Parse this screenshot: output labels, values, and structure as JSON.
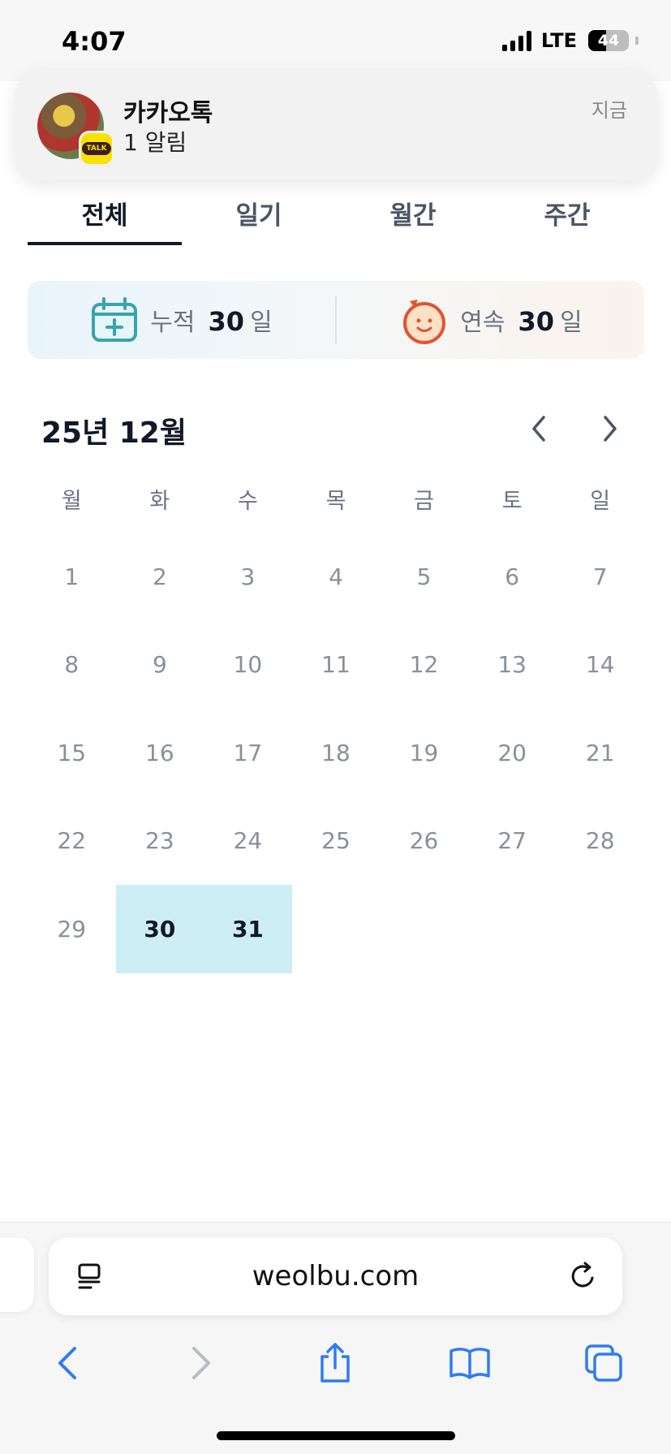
{
  "status_bar": {
    "time": "4:07",
    "network": "LTE",
    "battery_percent": "44",
    "battery_level": 0.44
  },
  "notification": {
    "app_name": "카카오톡",
    "message": "1 알림",
    "time": "지금",
    "badge_text": "TALK",
    "badge_color": "#fae100"
  },
  "tabs": [
    {
      "label": "전체",
      "active": true
    },
    {
      "label": "일기",
      "active": false
    },
    {
      "label": "월간",
      "active": false
    },
    {
      "label": "주간",
      "active": false
    }
  ],
  "stats": {
    "cumulative": {
      "label": "누적",
      "value": "30",
      "unit": "일",
      "icon": "calendar-plus-icon"
    },
    "streak": {
      "label": "연속",
      "value": "30",
      "unit": "일",
      "icon": "smiley-face-icon"
    }
  },
  "calendar": {
    "month_title": "25년 12월",
    "weekdays": [
      "월",
      "화",
      "수",
      "목",
      "금",
      "토",
      "일"
    ],
    "days": [
      "1",
      "2",
      "3",
      "4",
      "5",
      "6",
      "7",
      "8",
      "9",
      "10",
      "11",
      "12",
      "13",
      "14",
      "15",
      "16",
      "17",
      "18",
      "19",
      "20",
      "21",
      "22",
      "23",
      "24",
      "25",
      "26",
      "27",
      "28",
      "29",
      "30",
      "31"
    ],
    "highlighted_days": [
      "30",
      "31"
    ],
    "highlight_color": "#cdeef5"
  },
  "browser": {
    "url": "weolbu.com",
    "toolbar": [
      "back-icon",
      "forward-icon",
      "share-icon",
      "bookmarks-icon",
      "tabs-icon"
    ]
  }
}
